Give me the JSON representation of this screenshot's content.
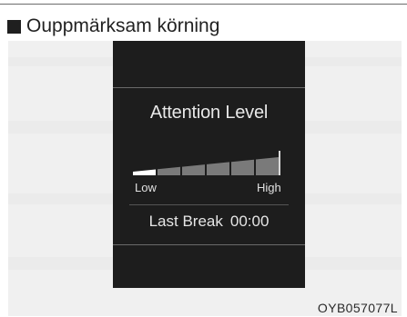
{
  "section": {
    "title": "Ouppmärksam körning"
  },
  "display": {
    "attention_title": "Attention Level",
    "level": {
      "segments_total": 6,
      "segments_active": 1,
      "min_label": "Low",
      "max_label": "High"
    },
    "last_break": {
      "label": "Last Break",
      "value": "00:00"
    }
  },
  "figure": {
    "code": "OYB057077L"
  },
  "colors": {
    "display_background": "#1d1d1d",
    "active_segment": "#ffffff",
    "inactive_segment": "#7a7a7a",
    "panel_background": "#f0f0f0"
  }
}
